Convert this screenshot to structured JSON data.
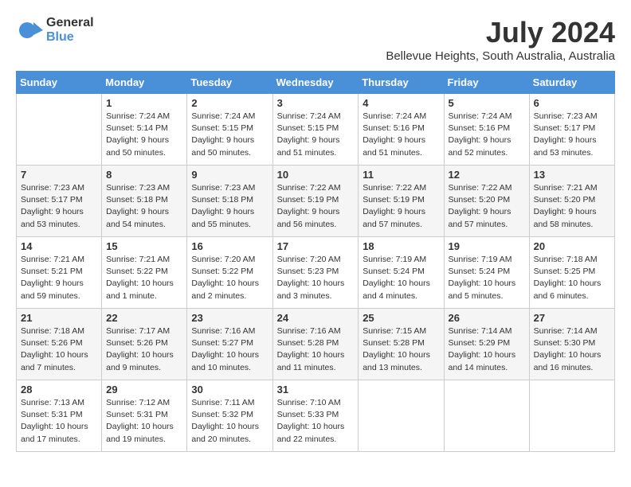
{
  "header": {
    "logo_general": "General",
    "logo_blue": "Blue",
    "month_title": "July 2024",
    "location": "Bellevue Heights, South Australia, Australia"
  },
  "days_of_week": [
    "Sunday",
    "Monday",
    "Tuesday",
    "Wednesday",
    "Thursday",
    "Friday",
    "Saturday"
  ],
  "weeks": [
    [
      {
        "day": "",
        "sunrise": "",
        "sunset": "",
        "daylight": ""
      },
      {
        "day": "1",
        "sunrise": "Sunrise: 7:24 AM",
        "sunset": "Sunset: 5:14 PM",
        "daylight": "Daylight: 9 hours and 50 minutes."
      },
      {
        "day": "2",
        "sunrise": "Sunrise: 7:24 AM",
        "sunset": "Sunset: 5:15 PM",
        "daylight": "Daylight: 9 hours and 50 minutes."
      },
      {
        "day": "3",
        "sunrise": "Sunrise: 7:24 AM",
        "sunset": "Sunset: 5:15 PM",
        "daylight": "Daylight: 9 hours and 51 minutes."
      },
      {
        "day": "4",
        "sunrise": "Sunrise: 7:24 AM",
        "sunset": "Sunset: 5:16 PM",
        "daylight": "Daylight: 9 hours and 51 minutes."
      },
      {
        "day": "5",
        "sunrise": "Sunrise: 7:24 AM",
        "sunset": "Sunset: 5:16 PM",
        "daylight": "Daylight: 9 hours and 52 minutes."
      },
      {
        "day": "6",
        "sunrise": "Sunrise: 7:23 AM",
        "sunset": "Sunset: 5:17 PM",
        "daylight": "Daylight: 9 hours and 53 minutes."
      }
    ],
    [
      {
        "day": "7",
        "sunrise": "Sunrise: 7:23 AM",
        "sunset": "Sunset: 5:17 PM",
        "daylight": "Daylight: 9 hours and 53 minutes."
      },
      {
        "day": "8",
        "sunrise": "Sunrise: 7:23 AM",
        "sunset": "Sunset: 5:18 PM",
        "daylight": "Daylight: 9 hours and 54 minutes."
      },
      {
        "day": "9",
        "sunrise": "Sunrise: 7:23 AM",
        "sunset": "Sunset: 5:18 PM",
        "daylight": "Daylight: 9 hours and 55 minutes."
      },
      {
        "day": "10",
        "sunrise": "Sunrise: 7:22 AM",
        "sunset": "Sunset: 5:19 PM",
        "daylight": "Daylight: 9 hours and 56 minutes."
      },
      {
        "day": "11",
        "sunrise": "Sunrise: 7:22 AM",
        "sunset": "Sunset: 5:19 PM",
        "daylight": "Daylight: 9 hours and 57 minutes."
      },
      {
        "day": "12",
        "sunrise": "Sunrise: 7:22 AM",
        "sunset": "Sunset: 5:20 PM",
        "daylight": "Daylight: 9 hours and 57 minutes."
      },
      {
        "day": "13",
        "sunrise": "Sunrise: 7:21 AM",
        "sunset": "Sunset: 5:20 PM",
        "daylight": "Daylight: 9 hours and 58 minutes."
      }
    ],
    [
      {
        "day": "14",
        "sunrise": "Sunrise: 7:21 AM",
        "sunset": "Sunset: 5:21 PM",
        "daylight": "Daylight: 9 hours and 59 minutes."
      },
      {
        "day": "15",
        "sunrise": "Sunrise: 7:21 AM",
        "sunset": "Sunset: 5:22 PM",
        "daylight": "Daylight: 10 hours and 1 minute."
      },
      {
        "day": "16",
        "sunrise": "Sunrise: 7:20 AM",
        "sunset": "Sunset: 5:22 PM",
        "daylight": "Daylight: 10 hours and 2 minutes."
      },
      {
        "day": "17",
        "sunrise": "Sunrise: 7:20 AM",
        "sunset": "Sunset: 5:23 PM",
        "daylight": "Daylight: 10 hours and 3 minutes."
      },
      {
        "day": "18",
        "sunrise": "Sunrise: 7:19 AM",
        "sunset": "Sunset: 5:24 PM",
        "daylight": "Daylight: 10 hours and 4 minutes."
      },
      {
        "day": "19",
        "sunrise": "Sunrise: 7:19 AM",
        "sunset": "Sunset: 5:24 PM",
        "daylight": "Daylight: 10 hours and 5 minutes."
      },
      {
        "day": "20",
        "sunrise": "Sunrise: 7:18 AM",
        "sunset": "Sunset: 5:25 PM",
        "daylight": "Daylight: 10 hours and 6 minutes."
      }
    ],
    [
      {
        "day": "21",
        "sunrise": "Sunrise: 7:18 AM",
        "sunset": "Sunset: 5:26 PM",
        "daylight": "Daylight: 10 hours and 7 minutes."
      },
      {
        "day": "22",
        "sunrise": "Sunrise: 7:17 AM",
        "sunset": "Sunset: 5:26 PM",
        "daylight": "Daylight: 10 hours and 9 minutes."
      },
      {
        "day": "23",
        "sunrise": "Sunrise: 7:16 AM",
        "sunset": "Sunset: 5:27 PM",
        "daylight": "Daylight: 10 hours and 10 minutes."
      },
      {
        "day": "24",
        "sunrise": "Sunrise: 7:16 AM",
        "sunset": "Sunset: 5:28 PM",
        "daylight": "Daylight: 10 hours and 11 minutes."
      },
      {
        "day": "25",
        "sunrise": "Sunrise: 7:15 AM",
        "sunset": "Sunset: 5:28 PM",
        "daylight": "Daylight: 10 hours and 13 minutes."
      },
      {
        "day": "26",
        "sunrise": "Sunrise: 7:14 AM",
        "sunset": "Sunset: 5:29 PM",
        "daylight": "Daylight: 10 hours and 14 minutes."
      },
      {
        "day": "27",
        "sunrise": "Sunrise: 7:14 AM",
        "sunset": "Sunset: 5:30 PM",
        "daylight": "Daylight: 10 hours and 16 minutes."
      }
    ],
    [
      {
        "day": "28",
        "sunrise": "Sunrise: 7:13 AM",
        "sunset": "Sunset: 5:31 PM",
        "daylight": "Daylight: 10 hours and 17 minutes."
      },
      {
        "day": "29",
        "sunrise": "Sunrise: 7:12 AM",
        "sunset": "Sunset: 5:31 PM",
        "daylight": "Daylight: 10 hours and 19 minutes."
      },
      {
        "day": "30",
        "sunrise": "Sunrise: 7:11 AM",
        "sunset": "Sunset: 5:32 PM",
        "daylight": "Daylight: 10 hours and 20 minutes."
      },
      {
        "day": "31",
        "sunrise": "Sunrise: 7:10 AM",
        "sunset": "Sunset: 5:33 PM",
        "daylight": "Daylight: 10 hours and 22 minutes."
      },
      {
        "day": "",
        "sunrise": "",
        "sunset": "",
        "daylight": ""
      },
      {
        "day": "",
        "sunrise": "",
        "sunset": "",
        "daylight": ""
      },
      {
        "day": "",
        "sunrise": "",
        "sunset": "",
        "daylight": ""
      }
    ]
  ]
}
